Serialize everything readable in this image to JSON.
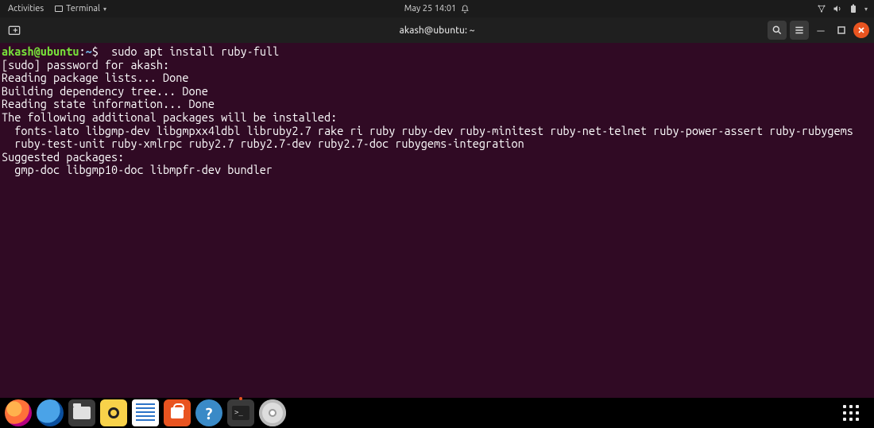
{
  "topbar": {
    "activities": "Activities",
    "terminal_label": "Terminal",
    "date_time": "May 25  14:01"
  },
  "titlebar": {
    "title": "akash@ubuntu: ~"
  },
  "terminal": {
    "prompt_user_host": "akash@ubuntu",
    "prompt_colon": ":",
    "prompt_path": "~",
    "prompt_dollar": "$",
    "command": "  sudo apt install ruby-full",
    "lines": [
      "[sudo] password for akash: ",
      "Reading package lists... Done",
      "Building dependency tree... Done",
      "Reading state information... Done",
      "The following additional packages will be installed:",
      "  fonts-lato libgmp-dev libgmpxx4ldbl libruby2.7 rake ri ruby ruby-dev ruby-minitest ruby-net-telnet ruby-power-assert ruby-rubygems",
      "  ruby-test-unit ruby-xmlrpc ruby2.7 ruby2.7-dev ruby2.7-doc rubygems-integration",
      "Suggested packages:",
      "  gmp-doc libgmp10-doc libmpfr-dev bundler"
    ]
  },
  "dock": {
    "items": [
      {
        "name": "firefox-icon"
      },
      {
        "name": "thunderbird-icon"
      },
      {
        "name": "files-icon"
      },
      {
        "name": "rhythmbox-icon"
      },
      {
        "name": "libreoffice-writer-icon"
      },
      {
        "name": "ubuntu-software-icon"
      },
      {
        "name": "help-icon"
      },
      {
        "name": "terminal-icon"
      },
      {
        "name": "disc-icon"
      }
    ]
  }
}
